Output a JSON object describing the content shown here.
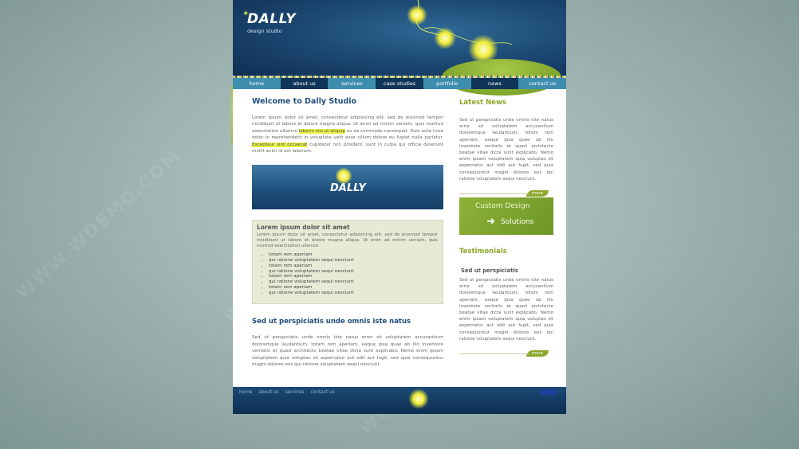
{
  "brand": {
    "name": "DALLY",
    "tagline": "design studio"
  },
  "nav": [
    {
      "label": "home",
      "style": "light"
    },
    {
      "label": "about us",
      "style": "dark"
    },
    {
      "label": "services",
      "style": "light"
    },
    {
      "label": "case studies",
      "style": "dark"
    },
    {
      "label": "portfolio",
      "style": "light"
    },
    {
      "label": "news",
      "style": "dark"
    },
    {
      "label": "contact us",
      "style": "light"
    }
  ],
  "main": {
    "welcome_title": "Welcome to Dally Studio",
    "welcome_p1": "Lorem ipsum dolor sit amet, consectetur adipisicing elit, sed do eiusmod tempor incididunt ut labore et dolore magna aliqua. Ut enim ad minim veniam, quis nostrud exercitation ullamco ",
    "welcome_hl1": "laboris nisi ut aliquip",
    "welcome_p2": " ex ea commodo consequat. Duis aute irure dolor in reprehenderit in voluptate velit esse cillum dolore eu fugiat nulla pariatur. ",
    "welcome_hl2": "Excepteur sint occaecat",
    "welcome_p3": " cupidatat non proident, sunt in culpa qui officia deserunt mollit anim id est laborum.",
    "banner_logo": "DALLY",
    "box_title": "Lorem ipsum dolor sit amet",
    "box_text": "Lorem ipsum dolor sit amet, consectetur adipisicing elit, sed do eiusmod tempor incididunt ut labore et dolore magna aliqua. Ut enim ad minim veniam, quis nostrud exercitation ullamco",
    "box_list": [
      "totam rem aperiam",
      "qui ratione voluptatem sequi nesciunt",
      "totam rem aperiam",
      "qui ratione voluptatem sequi nesciunt",
      "totam rem aperiam",
      "qui ratione voluptatem sequi nesciunt",
      "totam rem aperiam",
      "qui ratione voluptatem sequi nesciunt"
    ],
    "section_title": "Sed ut perspiciatis unde omnis iste natus",
    "section_text": "Sed ut perspiciatis unde omnis iste natus error sit voluptatem accusantium doloremque laudantium, totam rem aperiam, eaque ipsa quae ab illo inventore veritatis et quasi architecto beatae vitae dicta sunt explicabo. Nemo enim ipsam voluptatem quia voluptas sit aspernatur aut odit aut fugit, sed quia consequuntur magni dolores eos qui ratione voluptatem sequi nesciunt."
  },
  "side": {
    "news_title": "Latest News",
    "news_text": "Sed ut perspiciatis unde omnis iste natus error sit voluptatem accusantium doloremque laudantium, totam rem aperiam, eaque ipsa quae ab illo inventore veritatis et quasi architecto beatae vitae dicta sunt explicabo. Nemo enim ipsam voluptatem quia voluptas sit aspernatur aut odit aut fugit, sed quia consequuntur magni dolores eos qui ratione voluptatem sequi nesciunt.",
    "more_label": "more",
    "ad_line1": "Custom Design",
    "ad_line2": "Solutions",
    "testimonials_title": "Testimonials",
    "testimonial_sub": "Sed ut perspiciatis",
    "testimonial_text": "Sed ut perspiciatis unde omnis iste natus error sit voluptatem accusantium doloremque laudantium, totam rem aperiam, eaque ipsa quae ab illo inventore veritatis et quasi architecto beatae vitae dicta sunt explicabo. Nemo enim ipsam voluptatem quia voluptas sit aspernatur aut odit aut fugit, sed quia consequuntur magni dolores eos qui ratione voluptatem sequi nesciunt.",
    "more_label2": "more"
  },
  "footer": {
    "links": [
      "home",
      "about us",
      "services",
      "contact us"
    ]
  },
  "watermark": "WWW.WDEMO.COM",
  "colors": {
    "accent": "#8aa72a",
    "header_dark": "#0f2d52",
    "nav_light": "#3d8dae",
    "title_blue": "#1f4d7a",
    "highlight": "#e8f042"
  }
}
